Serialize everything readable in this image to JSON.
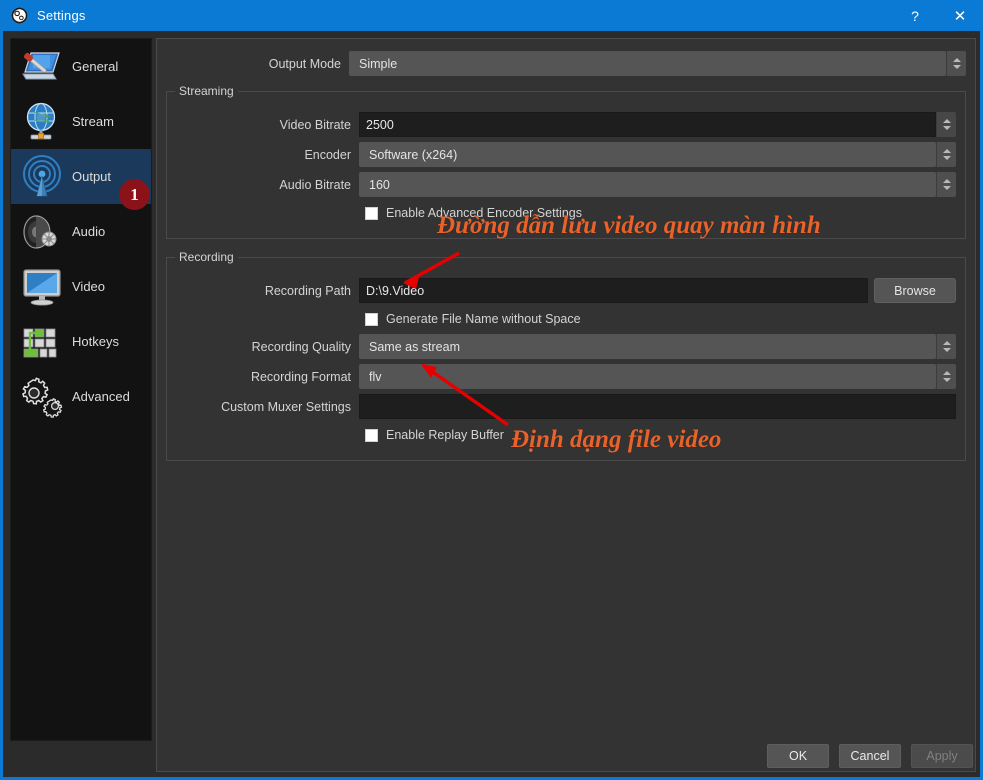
{
  "window": {
    "title": "Settings",
    "logo_icon": "obs-logo-icon",
    "help_label": "?",
    "close_label": "✕",
    "accent_color": "#0b7ad4"
  },
  "sidebar": {
    "items": [
      {
        "label": "General",
        "icon": "general-icon",
        "selected": false
      },
      {
        "label": "Stream",
        "icon": "stream-icon",
        "selected": false
      },
      {
        "label": "Output",
        "icon": "output-icon",
        "selected": true
      },
      {
        "label": "Audio",
        "icon": "audio-icon",
        "selected": false
      },
      {
        "label": "Video",
        "icon": "video-icon",
        "selected": false
      },
      {
        "label": "Hotkeys",
        "icon": "hotkeys-icon",
        "selected": false
      },
      {
        "label": "Advanced",
        "icon": "advanced-icon",
        "selected": false
      }
    ],
    "badge": {
      "text": "1",
      "color": "#8c1219"
    }
  },
  "output_mode": {
    "label": "Output Mode",
    "value": "Simple"
  },
  "streaming": {
    "title": "Streaming",
    "video_bitrate": {
      "label": "Video Bitrate",
      "value": "2500"
    },
    "encoder": {
      "label": "Encoder",
      "value": "Software (x264)"
    },
    "audio_bitrate": {
      "label": "Audio Bitrate",
      "value": "160"
    },
    "advanced_encoder": {
      "label": "Enable Advanced Encoder Settings",
      "checked": false
    }
  },
  "recording": {
    "title": "Recording",
    "path": {
      "label": "Recording Path",
      "value": "D:\\9.Video"
    },
    "browse_label": "Browse",
    "no_space": {
      "label": "Generate File Name without Space",
      "checked": false
    },
    "quality": {
      "label": "Recording Quality",
      "value": "Same as stream"
    },
    "format": {
      "label": "Recording Format",
      "value": "flv"
    },
    "muxer": {
      "label": "Custom Muxer Settings",
      "value": ""
    },
    "replay_buffer": {
      "label": "Enable Replay Buffer",
      "checked": false
    }
  },
  "annotations": {
    "color": "#e8622a",
    "arrow_color": "#e60000",
    "path_note": "Đường dẫn lưu video quay màn hình",
    "format_note": "Định dạng file video"
  },
  "footer": {
    "ok_label": "OK",
    "cancel_label": "Cancel",
    "apply_label": "Apply"
  }
}
